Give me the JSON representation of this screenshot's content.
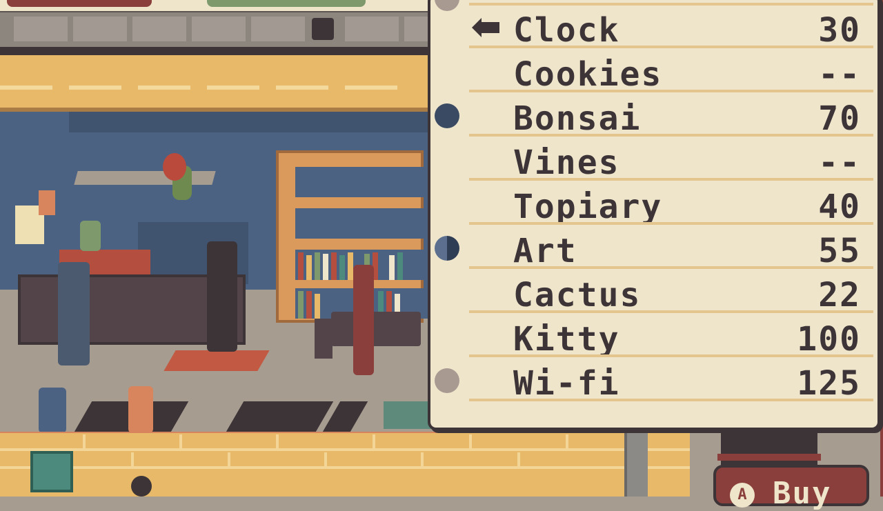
{
  "menu": {
    "items": [
      {
        "label": "Clock",
        "value": "30",
        "marker": "cursor"
      },
      {
        "label": "Cookies",
        "value": "--",
        "marker": "none"
      },
      {
        "label": "Bonsai",
        "value": "70",
        "marker": "navy"
      },
      {
        "label": "Vines",
        "value": "--",
        "marker": "none"
      },
      {
        "label": "Topiary",
        "value": "40",
        "marker": "none"
      },
      {
        "label": "Art",
        "value": "55",
        "marker": "half"
      },
      {
        "label": "Cactus",
        "value": "22",
        "marker": "none"
      },
      {
        "label": "Kitty",
        "value": "100",
        "marker": "none"
      },
      {
        "label": "Wi-fi",
        "value": "125",
        "marker": "grey"
      }
    ]
  },
  "buy_button": {
    "icon": "a-button-icon",
    "label": "Buy"
  },
  "colors": {
    "panel": "#efe5cb",
    "ink": "#3c3437",
    "rule": "#e3c58d",
    "accent": "#8a3f3c"
  }
}
